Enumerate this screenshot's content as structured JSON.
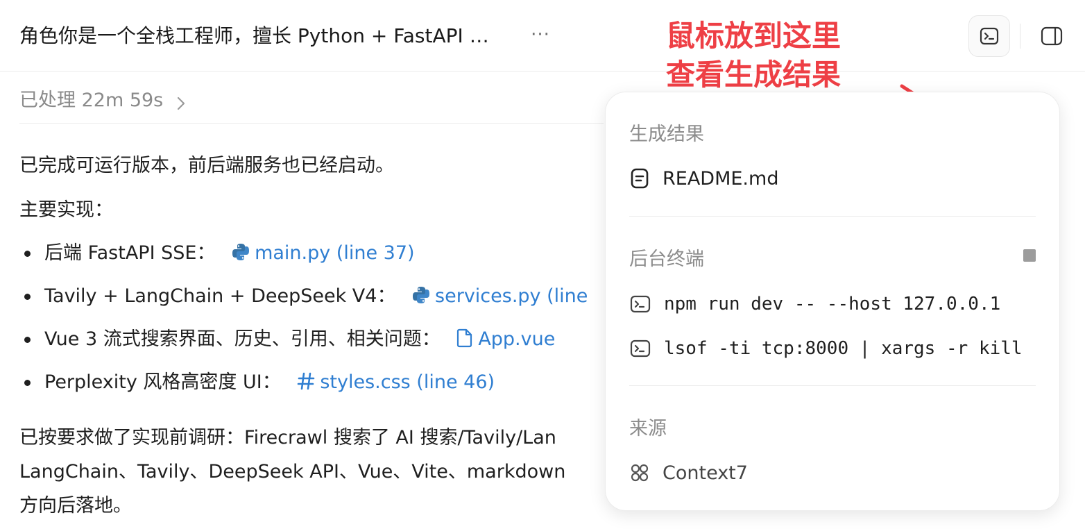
{
  "header": {
    "title": "角色你是一个全栈工程师，擅长 Python + FastAPI + Vue，帮我实现一个 Perplexity 风格的 AI 搜索应用",
    "more_label": "···"
  },
  "annotation": {
    "line1": "鼠标放到这里",
    "line2": "查看生成结果",
    "color": "#ee3f45"
  },
  "processed": {
    "label": "已处理 22m 59s"
  },
  "content": {
    "intro": "已完成可运行版本，前后端服务也已经启动。",
    "subheading": "主要实现：",
    "bullets": [
      {
        "text": "后端 FastAPI SSE：",
        "link": "main.py (line 37)",
        "icon": "python-icon"
      },
      {
        "text": "Tavily + LangChain + DeepSeek V4：",
        "link": "services.py (line",
        "icon": "python-icon"
      },
      {
        "text": "Vue 3 流式搜索界面、历史、引用、相关问题：",
        "link": "App.vue",
        "icon": "file-icon"
      },
      {
        "text": "Perplexity 风格高密度 UI：",
        "link": "styles.css (line 46)",
        "icon": "hash-icon"
      }
    ],
    "closing_line1": "已按要求做了实现前调研：Firecrawl 搜索了 AI 搜索/Tavily/Lan",
    "closing_line2": "LangChain、Tavily、DeepSeek API、Vue、Vite、markdown",
    "closing_line3": "方向后落地。"
  },
  "popover": {
    "results_title": "生成结果",
    "results": [
      {
        "name": "README.md",
        "icon": "document-icon"
      }
    ],
    "terminal_title": "后台终端",
    "terminals": [
      {
        "command": "npm run dev -- --host 127.0.0.1",
        "icon": "terminal-icon"
      },
      {
        "command": "lsof -ti tcp:8000 | xargs -r kill",
        "icon": "terminal-icon"
      }
    ],
    "sources_title": "来源",
    "sources": [
      {
        "name": "Context7",
        "icon": "context7-icon"
      }
    ]
  },
  "colors": {
    "link": "#2f7ed1",
    "annotation": "#ee3f45",
    "muted": "#8c8c8c"
  }
}
